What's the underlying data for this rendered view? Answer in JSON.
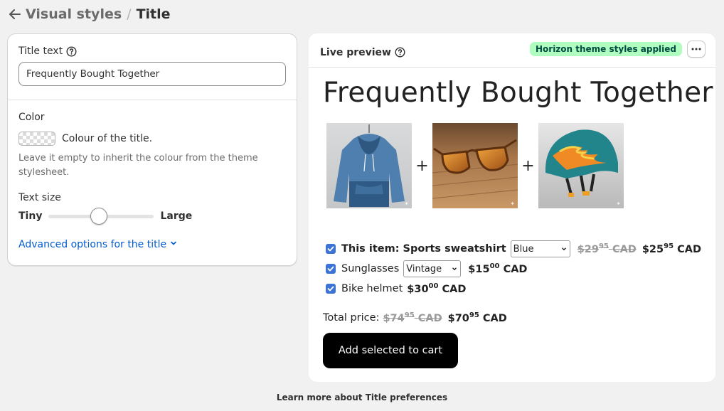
{
  "header": {
    "parent": "Visual styles",
    "separator": "/",
    "current": "Title"
  },
  "settings": {
    "title_text": {
      "label": "Title text",
      "value": "Frequently Bought Together"
    },
    "color": {
      "label": "Color",
      "swatch_label": "Colour of the title.",
      "help": "Leave it empty to inherit the colour from the theme stylesheet."
    },
    "text_size": {
      "label": "Text size",
      "min_label": "Tiny",
      "max_label": "Large",
      "level": 0.48
    },
    "advanced_link": "Advanced options for the title"
  },
  "preview": {
    "label": "Live preview",
    "badge": "Horizon theme styles applied",
    "badge_color": "#affebf",
    "title": "Frequently Bought Together",
    "plus": "+",
    "items": [
      {
        "checked": true,
        "name": "This item: Sports sweatshirt",
        "variant": "Blue",
        "old_price_main": "$29",
        "old_price_cents": "95",
        "old_currency": "CAD",
        "price_main": "$25",
        "price_cents": "95",
        "currency": "CAD"
      },
      {
        "checked": true,
        "name": "Sunglasses",
        "variant": "Vintage",
        "price_main": "$15",
        "price_cents": "00",
        "currency": "CAD"
      },
      {
        "checked": true,
        "name": "Bike helmet",
        "price_main": "$30",
        "price_cents": "00",
        "currency": "CAD"
      }
    ],
    "total": {
      "label": "Total price:",
      "old_main": "$74",
      "old_cents": "95",
      "old_currency": "CAD",
      "new_main": "$70",
      "new_cents": "95",
      "new_currency": "CAD"
    },
    "button": "Add selected to cart"
  },
  "footer": "Learn more about Title preferences",
  "colors": {
    "link": "#005bd3",
    "checkbox": "#3b73d6",
    "button": "#000000"
  }
}
